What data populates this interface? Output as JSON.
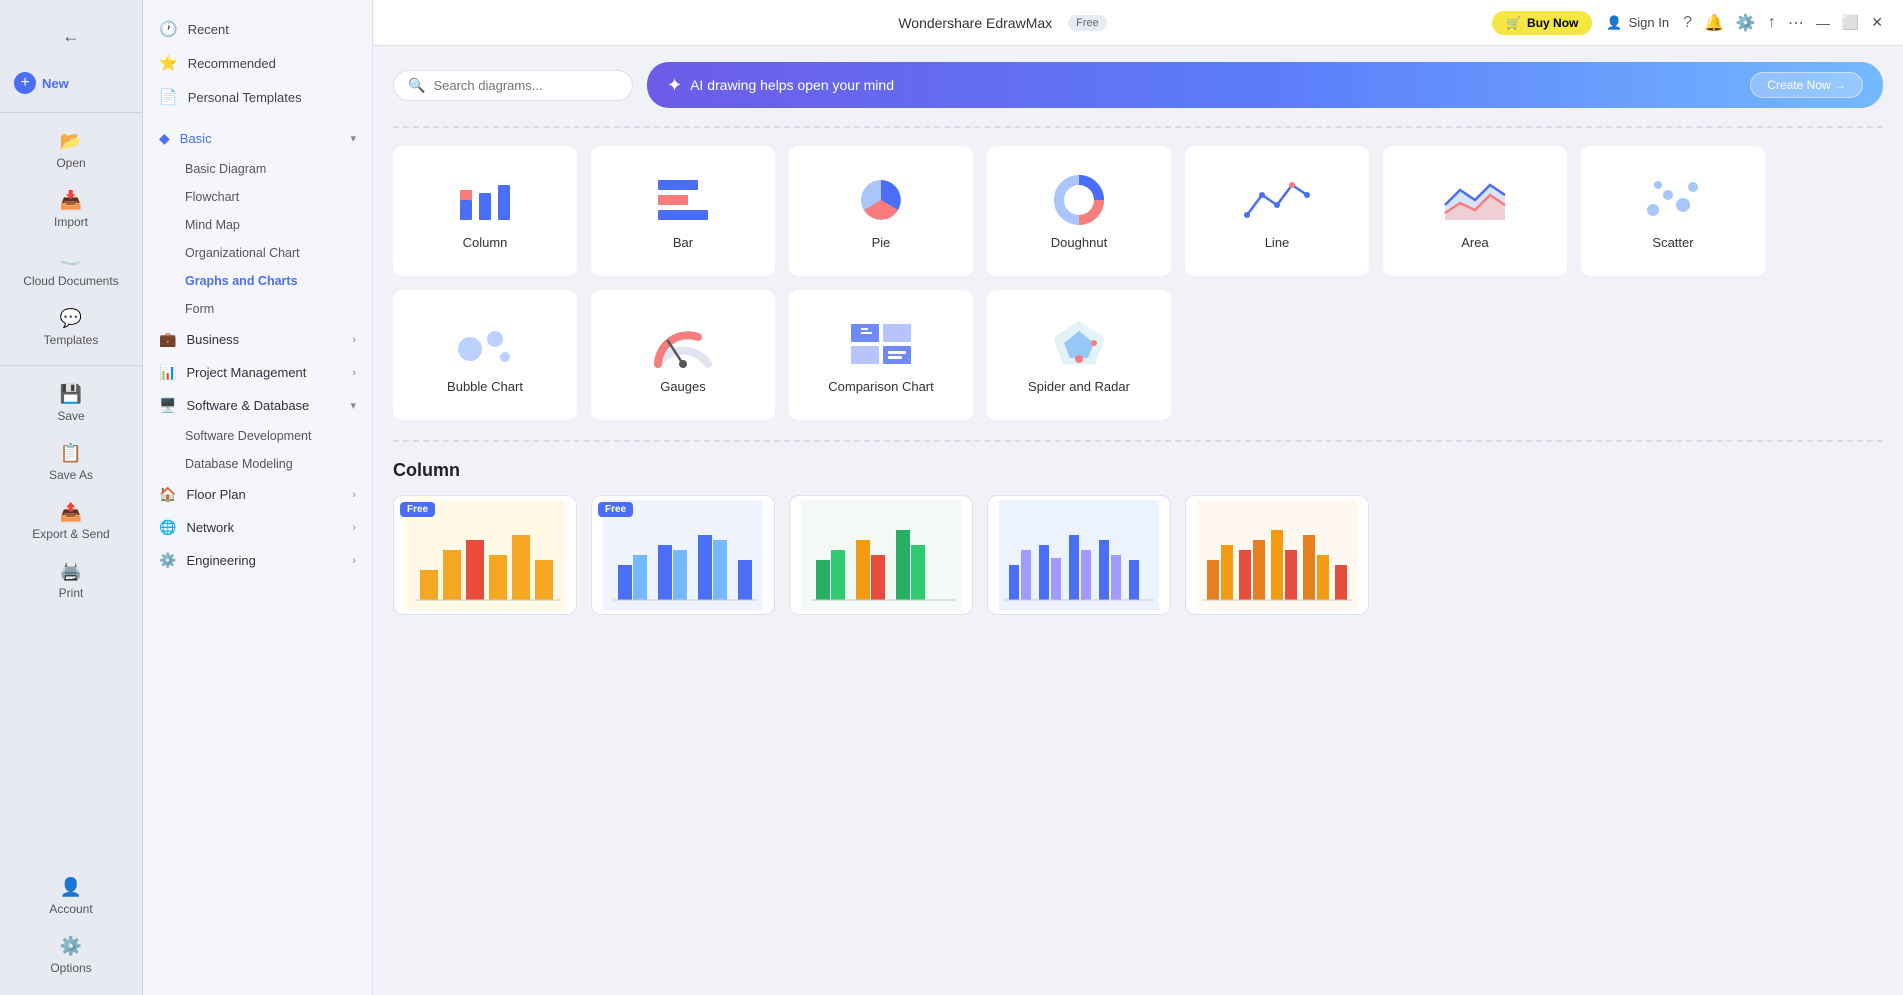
{
  "app": {
    "title": "Wondershare EdrawMax",
    "badge": "Free",
    "buy_now": "Buy Now",
    "sign_in": "Sign In"
  },
  "sidebar_narrow": {
    "items": [
      {
        "id": "new",
        "label": "New",
        "icon": "📄",
        "active": true
      },
      {
        "id": "open",
        "label": "Open",
        "icon": "📂"
      },
      {
        "id": "import",
        "label": "Import",
        "icon": "📥"
      },
      {
        "id": "cloud",
        "label": "Cloud Documents",
        "icon": "☁️"
      },
      {
        "id": "templates",
        "label": "Templates",
        "icon": "💬"
      },
      {
        "id": "save",
        "label": "Save",
        "icon": "💾"
      },
      {
        "id": "save-as",
        "label": "Save As",
        "icon": "📋"
      },
      {
        "id": "export",
        "label": "Export & Send",
        "icon": "📤"
      },
      {
        "id": "print",
        "label": "Print",
        "icon": "🖨️"
      }
    ],
    "bottom_items": [
      {
        "id": "account",
        "label": "Account",
        "icon": "👤"
      },
      {
        "id": "options",
        "label": "Options",
        "icon": "⚙️"
      }
    ]
  },
  "sidebar_wide": {
    "top_items": [
      {
        "id": "recent",
        "label": "Recent",
        "icon": "🕐"
      },
      {
        "id": "recommended",
        "label": "Recommended",
        "icon": "⭐"
      },
      {
        "id": "personal",
        "label": "Personal Templates",
        "icon": "📄"
      }
    ],
    "categories": [
      {
        "id": "basic",
        "label": "Basic",
        "icon": "◆",
        "active": true,
        "expanded": true,
        "sub_items": [
          {
            "id": "basic-diagram",
            "label": "Basic Diagram"
          },
          {
            "id": "flowchart",
            "label": "Flowchart"
          },
          {
            "id": "mind-map",
            "label": "Mind Map"
          },
          {
            "id": "org-chart",
            "label": "Organizational Chart"
          },
          {
            "id": "graphs-charts",
            "label": "Graphs and Charts",
            "active": true
          },
          {
            "id": "form",
            "label": "Form"
          }
        ]
      },
      {
        "id": "business",
        "label": "Business",
        "icon": "💼",
        "expanded": false
      },
      {
        "id": "project",
        "label": "Project Management",
        "icon": "📊",
        "expanded": false
      },
      {
        "id": "software-db",
        "label": "Software & Database",
        "icon": "🖥️",
        "expanded": true,
        "sub_items": [
          {
            "id": "sw-dev",
            "label": "Software Development"
          },
          {
            "id": "db-model",
            "label": "Database Modeling"
          }
        ]
      },
      {
        "id": "floor-plan",
        "label": "Floor Plan",
        "icon": "🏠",
        "expanded": false
      },
      {
        "id": "network",
        "label": "Network",
        "icon": "🌐",
        "expanded": false
      },
      {
        "id": "engineering",
        "label": "Engineering",
        "icon": "⚙️",
        "expanded": false
      }
    ]
  },
  "search": {
    "placeholder": "Search diagrams..."
  },
  "ai_banner": {
    "icon": "✦",
    "text": "AI drawing helps open your mind",
    "button": "Create Now →"
  },
  "chart_types": [
    {
      "id": "column",
      "label": "Column",
      "type": "column"
    },
    {
      "id": "bar",
      "label": "Bar",
      "type": "bar"
    },
    {
      "id": "pie",
      "label": "Pie",
      "type": "pie"
    },
    {
      "id": "doughnut",
      "label": "Doughnut",
      "type": "doughnut"
    },
    {
      "id": "line",
      "label": "Line",
      "type": "line"
    },
    {
      "id": "area",
      "label": "Area",
      "type": "area"
    },
    {
      "id": "scatter",
      "label": "Scatter",
      "type": "scatter"
    },
    {
      "id": "bubble",
      "label": "Bubble Chart",
      "type": "bubble"
    },
    {
      "id": "gauges",
      "label": "Gauges",
      "type": "gauges"
    },
    {
      "id": "comparison",
      "label": "Comparison Chart",
      "type": "comparison"
    },
    {
      "id": "spider",
      "label": "Spider and Radar",
      "type": "spider"
    }
  ],
  "section_title": "Column",
  "template_cards": [
    {
      "id": "t1",
      "free": true,
      "color": "#ffd700"
    },
    {
      "id": "t2",
      "free": true,
      "color": "#4a6ef5"
    },
    {
      "id": "t3",
      "free": false,
      "color": "#e8f4e8"
    },
    {
      "id": "t4",
      "free": false,
      "color": "#e8f0fe"
    },
    {
      "id": "t5",
      "free": false,
      "color": "#fff3e0"
    }
  ]
}
